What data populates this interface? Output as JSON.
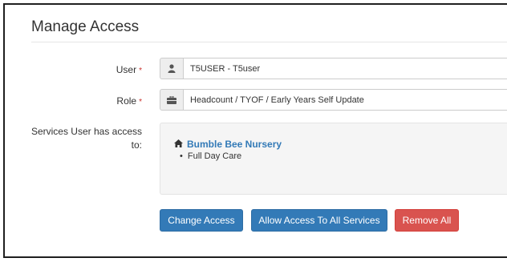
{
  "page": {
    "title": "Manage Access"
  },
  "form": {
    "user_label": "User",
    "user_value": "T5USER - T5user",
    "role_label": "Role",
    "role_value": "Headcount / TYOF / Early Years Self Update",
    "required_marker": "*",
    "services_label_line1": "Services User has access",
    "services_label_line2": "to:"
  },
  "services": [
    {
      "name": "Bumble Bee Nursery",
      "items": [
        "Full Day Care"
      ]
    }
  ],
  "buttons": {
    "change_access": "Change Access",
    "allow_all": "Allow Access To All Services",
    "remove_all": "Remove All"
  },
  "icons": {
    "user": "user-icon",
    "role": "briefcase-icon",
    "service": "home-icon"
  },
  "colors": {
    "primary": "#337ab7",
    "danger": "#d9534f",
    "required": "#c9302c"
  }
}
